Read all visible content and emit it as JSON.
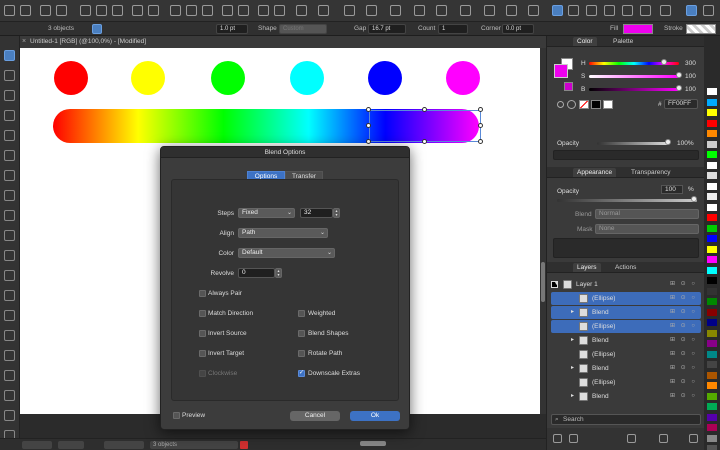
{
  "toolbar": {
    "objects_label": "3 objects",
    "stroke_width": "1.0 pt",
    "shape_label": "Shape",
    "shape_value": "Custom",
    "gap_label": "Gap",
    "gap_value": "16.7 pt",
    "count_label": "Count",
    "count_value": "1",
    "corner_label": "Corner",
    "corner_value": "0.0 pt",
    "fill_label": "Fill",
    "stroke_label": "Stroke",
    "fill_color": "#ee00ee"
  },
  "document": {
    "tab_title": "Untitled-1 [RGB] (@100,0%) - [Modified]",
    "dots": [
      {
        "color": "#ff0000"
      },
      {
        "color": "#ffff00"
      },
      {
        "color": "#00ff00"
      },
      {
        "color": "#00ffff"
      },
      {
        "color": "#0000ff"
      },
      {
        "color": "#ff00ff"
      }
    ]
  },
  "dialog": {
    "title": "Blend Options",
    "tabs": [
      "Options",
      "Transfer"
    ],
    "steps_label": "Steps",
    "steps_mode": "Fixed",
    "steps_value": "32",
    "align_label": "Align",
    "align_value": "Path",
    "color_label": "Color",
    "color_value": "Default",
    "revolve_label": "Revolve",
    "revolve_value": "0",
    "always_pair": "Always Pair",
    "match_direction": "Match Direction",
    "weighted": "Weighted",
    "invert_source": "Invert Source",
    "blend_shapes": "Blend Shapes",
    "invert_target": "Invert Target",
    "rotate_path": "Rotate Path",
    "clockwise": "Clockwise",
    "downscale_extras": "Downscale Extras",
    "preview": "Preview",
    "cancel": "Cancel",
    "ok": "Ok"
  },
  "color_panel": {
    "tabs": [
      "Color",
      "Palette"
    ],
    "h_label": "H",
    "h_value": "300",
    "s_label": "S",
    "s_value": "100",
    "b_label": "B",
    "b_value": "100",
    "h_fraction": 0.83,
    "hex_label": "#",
    "hex_value": "FF00FF",
    "opacity_label": "Opacity",
    "opacity_value": "100%"
  },
  "appearance_panel": {
    "tabs": [
      "Appearance",
      "Transparency"
    ],
    "opacity_label": "Opacity",
    "opacity_value": "100",
    "opacity_unit": "%",
    "blend_label": "Blend",
    "blend_value": "Normal",
    "mask_label": "Mask",
    "mask_value": "None"
  },
  "layers_panel": {
    "tabs": [
      "Layers",
      "Actions"
    ],
    "rows": [
      {
        "name": "Layer 1",
        "selected": false,
        "indent": 0,
        "expand": "▾"
      },
      {
        "name": "(Ellipse)",
        "selected": true,
        "indent": 1,
        "expand": ""
      },
      {
        "name": "Blend",
        "selected": true,
        "indent": 1,
        "expand": "▸"
      },
      {
        "name": "(Ellipse)",
        "selected": true,
        "indent": 1,
        "expand": ""
      },
      {
        "name": "Blend",
        "selected": false,
        "indent": 1,
        "expand": "▸"
      },
      {
        "name": "(Ellipse)",
        "selected": false,
        "indent": 1,
        "expand": ""
      },
      {
        "name": "Blend",
        "selected": false,
        "indent": 1,
        "expand": "▸"
      },
      {
        "name": "(Ellipse)",
        "selected": false,
        "indent": 1,
        "expand": ""
      },
      {
        "name": "Blend",
        "selected": false,
        "indent": 1,
        "expand": "▸"
      }
    ],
    "search_placeholder": "Search"
  },
  "statusbar": {
    "selection_info": "3 objects"
  },
  "swatches": [
    "#ffffff",
    "#00aaff",
    "#ffff00",
    "#ff0000",
    "#ff8800",
    "#cccccc",
    "#00ff00",
    "#ffffff",
    "#dddddd",
    "#ffffff",
    "#eeeeee",
    "#ffffff",
    "#ff0000",
    "#00cc00",
    "#0000ff",
    "#ffff00",
    "#ff00ff",
    "#00ffff",
    "#000000",
    "#333333",
    "#008800",
    "#880000",
    "#000088",
    "#888800",
    "#880088",
    "#008888",
    "#444444",
    "#aa5500",
    "#ff8800",
    "#55aa00",
    "#00aa55",
    "#5500aa",
    "#aa0055",
    "#888888",
    "#555555"
  ]
}
